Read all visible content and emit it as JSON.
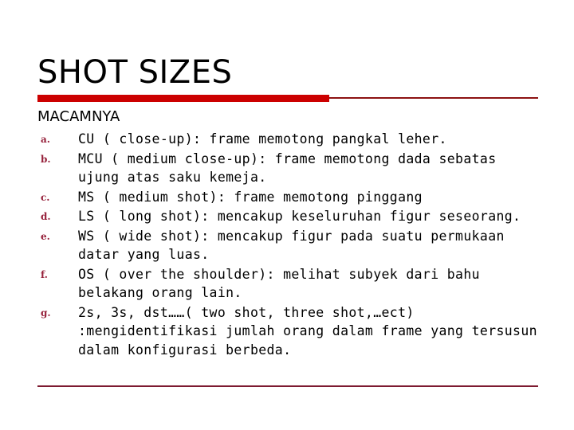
{
  "slide": {
    "title": "SHOT SIZES",
    "subheading": "MACAMNYA",
    "colors": {
      "title_text": "#000000",
      "accent_bar_thick": "#cc0000",
      "accent_bar_thin": "#8c1212",
      "marker": "#96203a",
      "bottom_rule": "#7d1a30",
      "background": "#ffffff"
    },
    "list": [
      {
        "marker": "a.",
        "text": "CU ( close-up): frame memotong pangkal leher."
      },
      {
        "marker": "b.",
        "text": "MCU ( medium close-up): frame memotong dada sebatas ujung atas saku kemeja."
      },
      {
        "marker": "c.",
        "text": "MS ( medium shot): frame memotong pinggang"
      },
      {
        "marker": "d.",
        "text": "LS ( long shot): mencakup keseluruhan figur seseorang."
      },
      {
        "marker": "e.",
        "text": "WS ( wide shot): mencakup figur pada suatu permukaan datar yang luas."
      },
      {
        "marker": "f.",
        "text": "OS ( over the shoulder): melihat subyek dari bahu belakang orang lain."
      },
      {
        "marker": "g.",
        "text": "2s, 3s, dst……( two shot, three shot,…ect) :mengidentifikasi jumlah orang dalam frame yang tersusun dalam konfigurasi berbeda."
      }
    ]
  }
}
